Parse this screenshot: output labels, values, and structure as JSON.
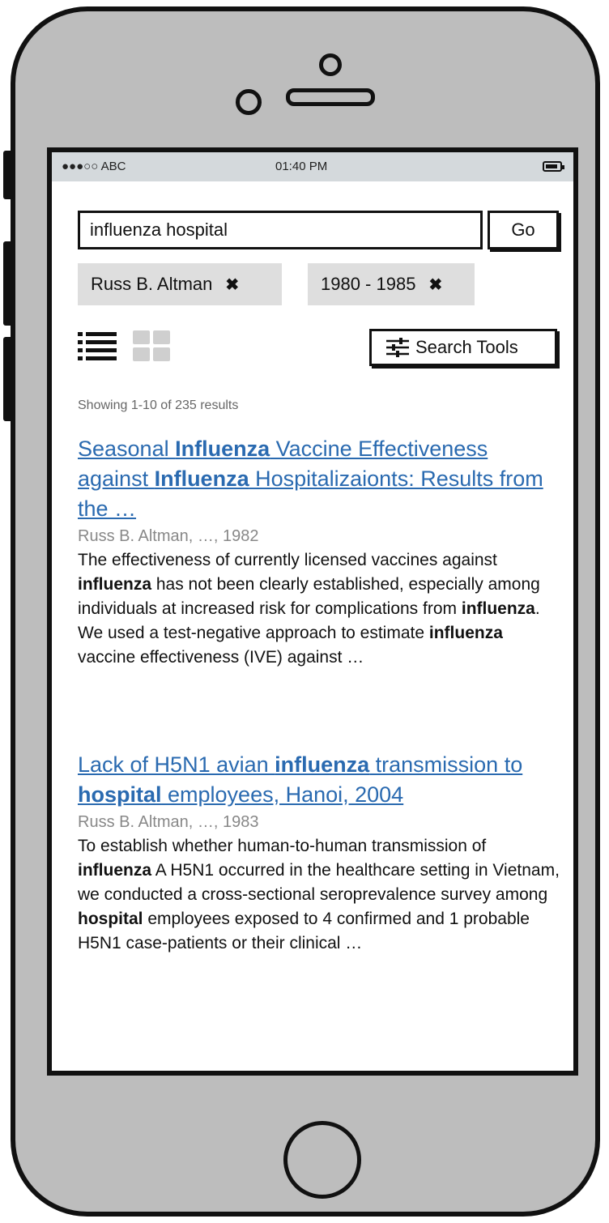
{
  "status_bar": {
    "carrier": "●●●○○ ABC",
    "time": "01:40 PM"
  },
  "search": {
    "value": "influenza hospital",
    "go_label": "Go"
  },
  "filters": [
    {
      "label": "Russ B. Altman",
      "remove": "✖"
    },
    {
      "label": "1980 - 1985",
      "remove": "✖"
    }
  ],
  "view_icons": {
    "list": "list-view-icon",
    "grid": "grid-view-icon"
  },
  "search_tools_label": "Search Tools",
  "showing": "Showing 1-10 of 235 results",
  "results": [
    {
      "title_parts": [
        "Seasonal ",
        "Influenza",
        " Vaccine Effectiveness against ",
        "Influenza",
        " Hospitalizaionts: Results from the …"
      ],
      "meta": "Russ B. Altman,  …, 1982",
      "snippet_parts": [
        "The effectiveness of currently licensed vaccines against ",
        "influenza",
        " has not been clearly established, especially among individuals at increased risk for complications from ",
        "influenza",
        ". We used a test-negative approach to estimate ",
        "influenza",
        " vaccine effectiveness (IVE) against …"
      ]
    },
    {
      "title_parts": [
        "Lack of H5N1 avian ",
        "influenza",
        " transmission to ",
        "hospital",
        " employees, Hanoi, 2004"
      ],
      "meta": "Russ B. Altman, …, 1983",
      "snippet_parts": [
        "To establish whether human-to-human transmission of ",
        "influenza",
        " A H5N1 occurred in the healthcare setting in Vietnam, we conducted a cross-sectional seroprevalence survey among ",
        "hospital",
        " employees exposed to 4 confirmed and 1 probable H5N1 case-patients or their clinical …"
      ]
    }
  ]
}
